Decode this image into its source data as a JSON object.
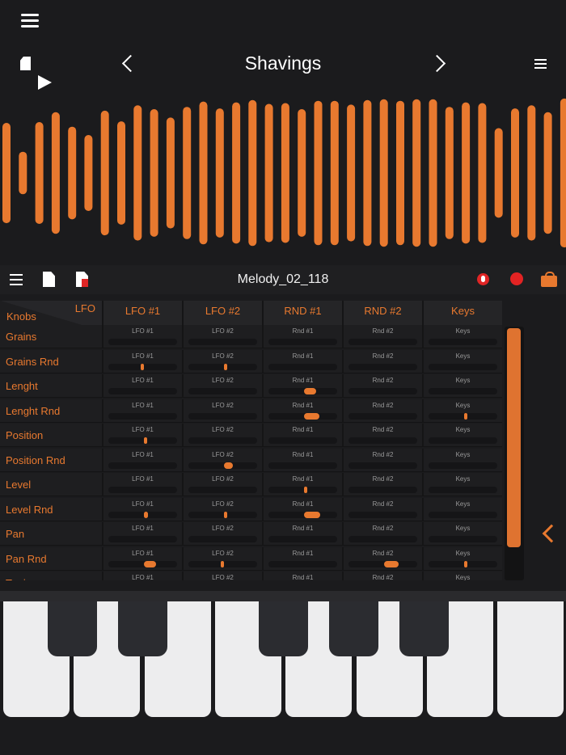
{
  "header": {
    "preset_title": "Shavings",
    "icons": {
      "menu": "hamburger-icon",
      "document": "document-icon",
      "play": "play-icon",
      "prev": "chevron-left-icon",
      "next": "chevron-right-icon",
      "preset_menu": "list-menu-icon"
    }
  },
  "waveform": {
    "color": "#e8792f",
    "bars": [
      0.66,
      0.28,
      0.67,
      0.8,
      0.61,
      0.5,
      0.82,
      0.68,
      0.89,
      0.84,
      0.73,
      0.87,
      0.94,
      0.85,
      0.93,
      0.96,
      0.91,
      0.92,
      0.84,
      0.95,
      0.95,
      0.9,
      0.96,
      0.97,
      0.95,
      0.97,
      0.97,
      0.87,
      0.93,
      0.92,
      0.59,
      0.85,
      0.89,
      0.8,
      0.98
    ]
  },
  "track": {
    "title": "Melody_02_118",
    "icons": {
      "list": "list-icon",
      "file": "file-icon",
      "file_red": "file-delete-icon",
      "mic": "microphone-icon",
      "record": "record-icon",
      "bag": "bag-icon"
    }
  },
  "matrix": {
    "corner_top": "LFO",
    "corner_bottom": "Knobs",
    "columns": [
      "LFO #1",
      "LFO #2",
      "RND #1",
      "RND #2",
      "Keys"
    ],
    "cell_labels": [
      "LFO #1",
      "LFO #2",
      "Rnd #1",
      "Rnd #2",
      "Keys"
    ],
    "rows": [
      {
        "label": "Grains",
        "amounts": [
          null,
          null,
          null,
          null,
          null
        ]
      },
      {
        "label": "Grains Rnd",
        "amounts": [
          -0.02,
          0.1,
          null,
          null,
          null
        ]
      },
      {
        "label": "Lenght",
        "amounts": [
          null,
          null,
          0.35,
          null,
          null
        ]
      },
      {
        "label": "Lenght Rnd",
        "amounts": [
          null,
          null,
          0.44,
          null,
          0.02
        ]
      },
      {
        "label": "Position",
        "amounts": [
          0.02,
          null,
          null,
          null,
          null
        ]
      },
      {
        "label": "Position Rnd",
        "amounts": [
          null,
          0.27,
          null,
          null,
          null
        ]
      },
      {
        "label": "Level",
        "amounts": [
          null,
          null,
          0.09,
          null,
          null
        ]
      },
      {
        "label": "Level Rnd",
        "amounts": [
          0.13,
          0.06,
          0.46,
          null,
          null
        ]
      },
      {
        "label": "Pan",
        "amounts": [
          null,
          null,
          null,
          null,
          null
        ]
      },
      {
        "label": "Pan Rnd",
        "amounts": [
          0.35,
          -0.01,
          null,
          0.42,
          0.02
        ]
      },
      {
        "label": "Tuning",
        "amounts": [
          null,
          null,
          null,
          null,
          null
        ]
      }
    ]
  },
  "scroll": {
    "position": 0.0,
    "visible_fraction": 0.86,
    "color": "#df7330"
  },
  "side": {
    "icon": "chevron-left-icon"
  },
  "keyboard": {
    "white_keys": 8,
    "black_keys": 5
  }
}
